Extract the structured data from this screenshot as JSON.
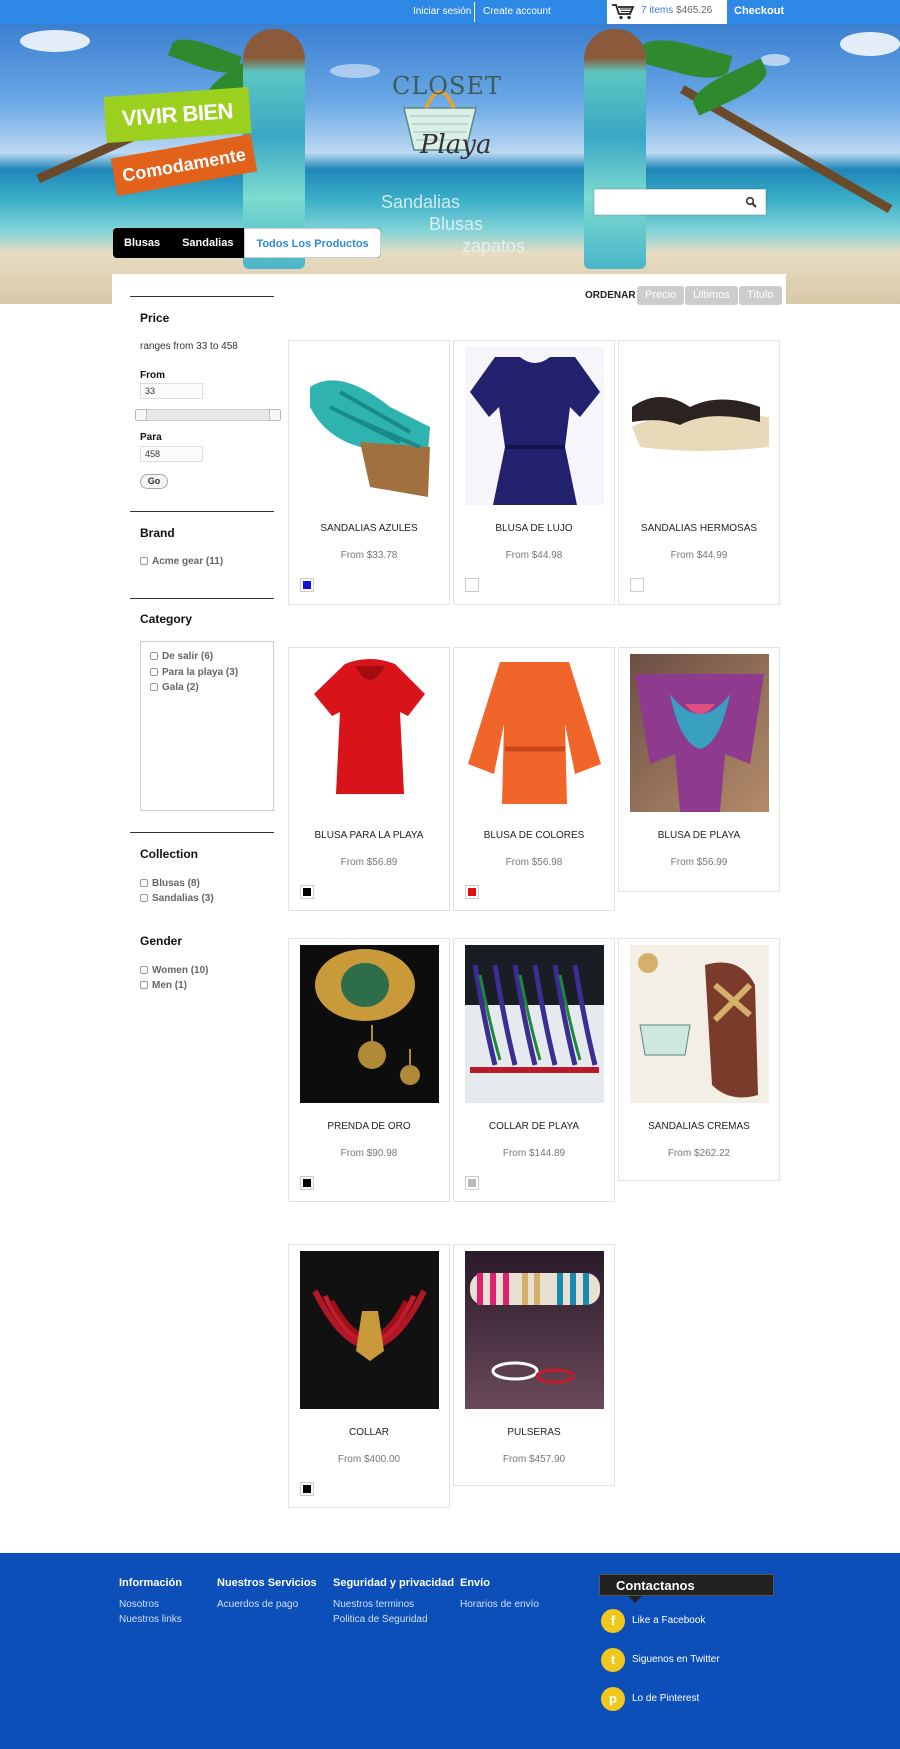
{
  "topbar": {
    "signin": "Iniciar sesión",
    "create_account": "Create account",
    "cart_items": "7 items",
    "cart_total": "$465.26",
    "checkout": "Checkout"
  },
  "banner": {
    "tagline_1": "VIVIR BIEN",
    "tagline_2": "Comodamente",
    "logo_word_1": "CLOSET",
    "logo_word_2": "Playa",
    "words": [
      "Sandalias",
      "Blusas",
      "zapatos"
    ]
  },
  "nav": {
    "tabs": [
      "Blusas",
      "Sandalias",
      "Todos Los Productos"
    ],
    "active_tab": "Todos Los Productos"
  },
  "sort": {
    "label": "ORDENAR",
    "options": [
      "Precio",
      "Últimos",
      "Titulo"
    ]
  },
  "sidebar": {
    "price": {
      "title": "Price",
      "range_text": "ranges from 33 to 458",
      "from_label": "From",
      "from_value": "33",
      "to_label": "Para",
      "to_value": "458",
      "go": "Go"
    },
    "brand": {
      "title": "Brand",
      "items": [
        "Acme gear (11)"
      ]
    },
    "category": {
      "title": "Category",
      "items": [
        "De salir (6)",
        "Para la playa (3)",
        "Gala (2)"
      ]
    },
    "collection": {
      "title": "Collection",
      "items": [
        "Blusas (8)",
        "Sandalias (3)"
      ]
    },
    "gender": {
      "title": "Gender",
      "items": [
        "Women (10)",
        "Men (1)"
      ]
    }
  },
  "products": [
    {
      "name": "SANDALIAS AZULES",
      "price": "From $33.78",
      "swatch": "#1212d8"
    },
    {
      "name": "BLUSA DE LUJO",
      "price": "From $44.98",
      "swatch": "#ffffff"
    },
    {
      "name": "SANDALIAS HERMOSAS",
      "price": "From $44.99",
      "swatch": "#ffffff"
    },
    {
      "name": "BLUSA PARA LA PLAYA",
      "price": "From $56.89",
      "swatch": "#000000"
    },
    {
      "name": "BLUSA DE COLORES",
      "price": "From $56.98",
      "swatch": "#e01010"
    },
    {
      "name": "BLUSA DE PLAYA",
      "price": "From $56.99",
      "swatch": null
    },
    {
      "name": "PRENDA DE ORO",
      "price": "From $90.98",
      "swatch": "#000000"
    },
    {
      "name": "COLLAR DE PLAYA",
      "price": "From $144.89",
      "swatch": "#bbbbbb"
    },
    {
      "name": "SANDALIAS CREMAS",
      "price": "From $262.22",
      "swatch": null
    },
    {
      "name": "COLLAR",
      "price": "From $400.00",
      "swatch": "#000000"
    },
    {
      "name": "PULSERAS",
      "price": "From $457.90",
      "swatch": null
    }
  ],
  "footer": {
    "columns": [
      {
        "title": "Información",
        "links": [
          "Nosotros",
          "Nuestros links"
        ]
      },
      {
        "title": "Nuestros Servicios",
        "links": [
          "Acuerdos de pago"
        ]
      },
      {
        "title": "Seguridad y privacidad",
        "links": [
          "Nuestros terminos",
          "Politica de Seguridad"
        ]
      },
      {
        "title": "Envío",
        "links": [
          "Horarios de envío"
        ]
      }
    ],
    "contact_title": "Contactanos",
    "social": [
      {
        "icon": "facebook-icon",
        "glyph": "f",
        "label": "Like a Facebook"
      },
      {
        "icon": "twitter-icon",
        "glyph": "t",
        "label": "Siguenos en Twitter"
      },
      {
        "icon": "pinterest-icon",
        "glyph": "p",
        "label": "Lo de Pinterest"
      }
    ]
  },
  "colors": {
    "topbar": "#2e88e6",
    "footer": "#0c4fb8",
    "accent": "#2d88d8",
    "sort_button": "#cccccc"
  }
}
